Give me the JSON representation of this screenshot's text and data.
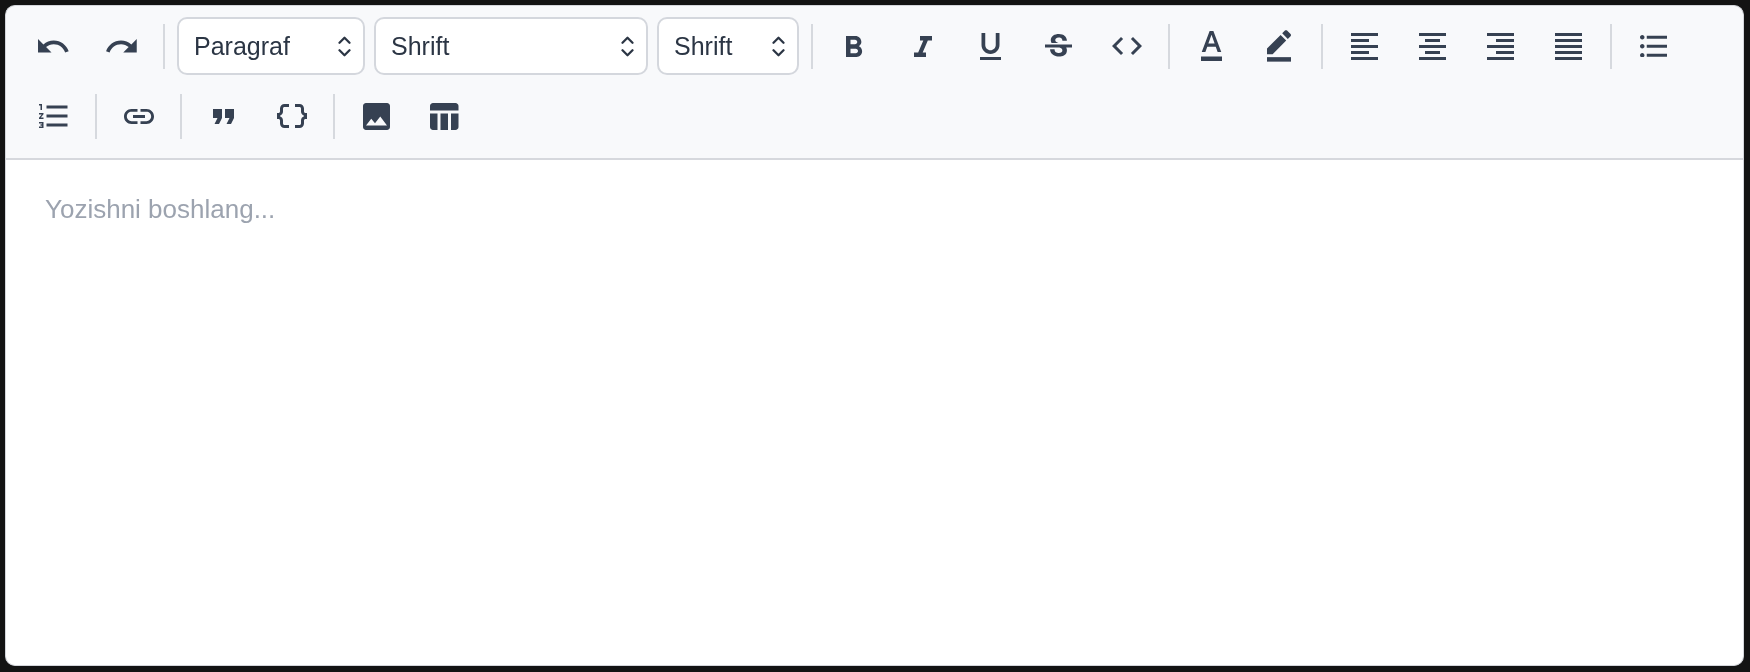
{
  "toolbar": {
    "items": [
      {
        "kind": "undo"
      },
      {
        "kind": "redo"
      },
      {
        "kind": "separator"
      },
      {
        "kind": "select",
        "value": "Paragraf"
      },
      {
        "kind": "select",
        "value": "Shrift"
      },
      {
        "kind": "select",
        "value": "Shrift"
      },
      {
        "kind": "separator"
      },
      {
        "kind": "bold"
      },
      {
        "kind": "italic"
      },
      {
        "kind": "underline"
      },
      {
        "kind": "strikethrough"
      },
      {
        "kind": "code"
      },
      {
        "kind": "separator"
      },
      {
        "kind": "text-color"
      },
      {
        "kind": "highlight"
      },
      {
        "kind": "separator"
      },
      {
        "kind": "align-left"
      },
      {
        "kind": "align-center"
      },
      {
        "kind": "align-right"
      },
      {
        "kind": "align-justify"
      },
      {
        "kind": "separator"
      },
      {
        "kind": "bullet-list"
      },
      {
        "kind": "numbered-list"
      },
      {
        "kind": "separator"
      },
      {
        "kind": "link"
      },
      {
        "kind": "separator"
      },
      {
        "kind": "quote"
      },
      {
        "kind": "braces"
      },
      {
        "kind": "separator"
      },
      {
        "kind": "image"
      },
      {
        "kind": "table"
      }
    ]
  },
  "editor": {
    "placeholder": "Yozishni boshlang..."
  }
}
